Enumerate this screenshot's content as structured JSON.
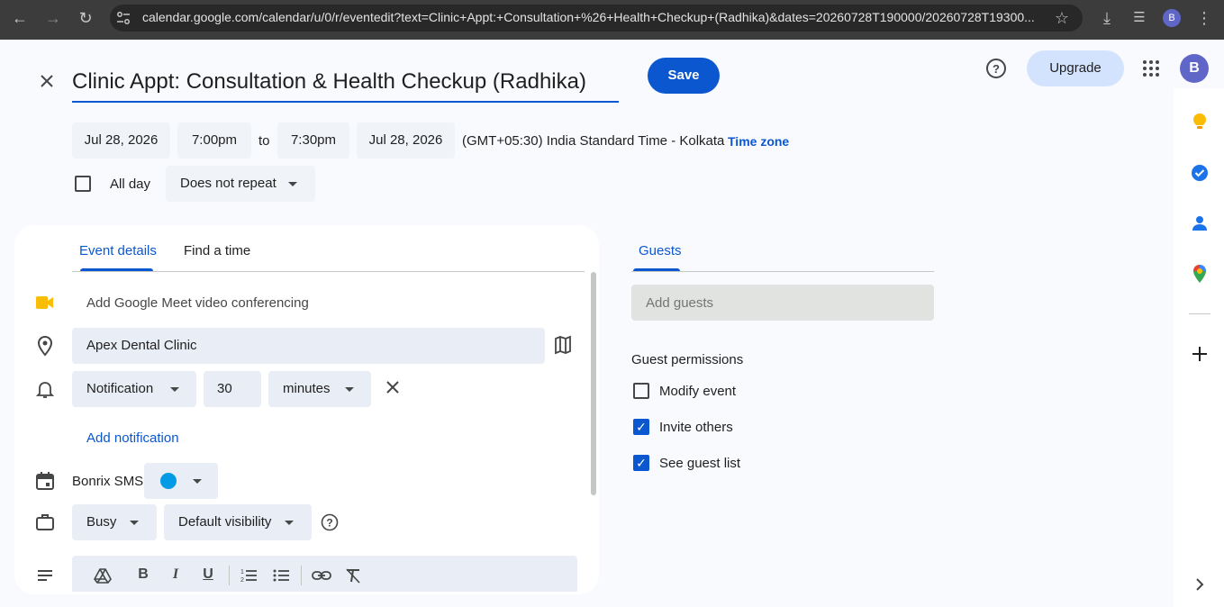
{
  "browser": {
    "url": "calendar.google.com/calendar/u/0/r/eventedit?text=Clinic+Appt:+Consultation+%26+Health+Checkup+(Radhika)&dates=20260728T190000/20260728T19300...",
    "profile_initial": "B"
  },
  "header": {
    "title": "Clinic Appt: Consultation & Health Checkup (Radhika)",
    "save_label": "Save",
    "upgrade_label": "Upgrade",
    "avatar_initial": "B"
  },
  "datetime": {
    "start_date": "Jul 28, 2026",
    "start_time": "7:00pm",
    "to_label": "to",
    "end_time": "7:30pm",
    "end_date": "Jul 28, 2026",
    "timezone_text": "(GMT+05:30) India Standard Time - Kolkata",
    "timezone_link": "Time zone",
    "all_day_label": "All day",
    "repeat_label": "Does not repeat"
  },
  "details": {
    "tabs": [
      "Event details",
      "Find a time"
    ],
    "meet_label": "Add Google Meet video conferencing",
    "location_value": "Apex Dental Clinic",
    "notification_type": "Notification",
    "notification_amount": "30",
    "notification_unit": "minutes",
    "add_notification_label": "Add notification",
    "calendar_name": "Bonrix SMS",
    "calendar_color": "#039be5",
    "availability": "Busy",
    "visibility": "Default visibility"
  },
  "guests": {
    "tab_label": "Guests",
    "add_guests_placeholder": "Add guests",
    "permissions_heading": "Guest permissions",
    "permissions": [
      {
        "label": "Modify event",
        "checked": false
      },
      {
        "label": "Invite others",
        "checked": true
      },
      {
        "label": "See guest list",
        "checked": true
      }
    ]
  },
  "colors": {
    "accent": "#0b57d0",
    "keep": "#fbbc04",
    "tasks": "#1a73e8",
    "contacts": "#1a73e8"
  }
}
